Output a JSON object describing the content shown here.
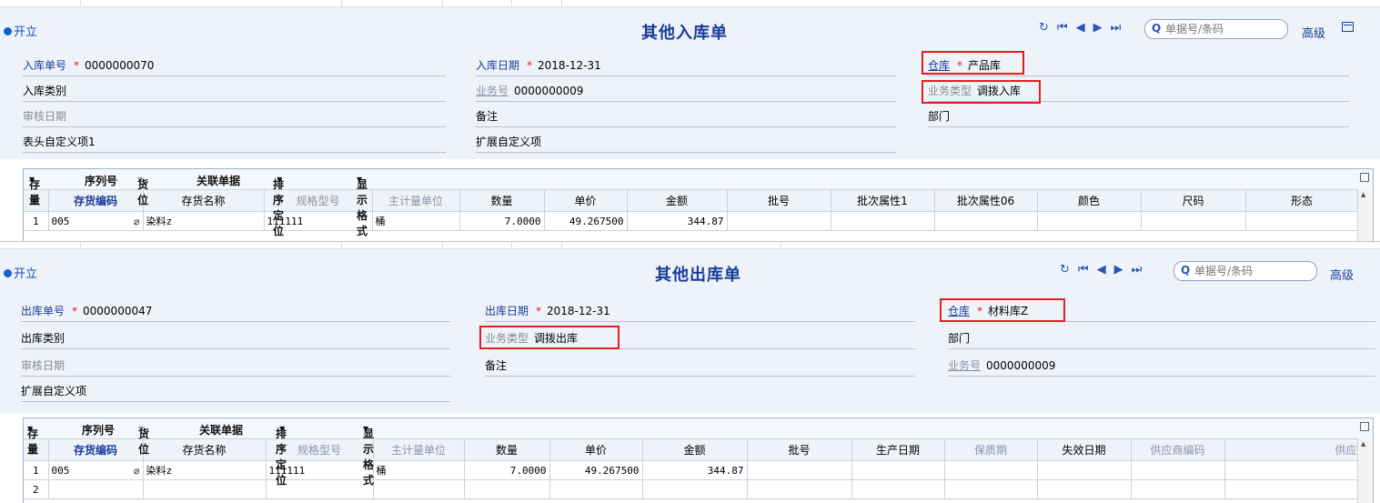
{
  "inbound": {
    "open_label": "开立",
    "title": "其他入库单",
    "search_placeholder": "单据号/条码",
    "advanced_label": "高级",
    "fields": {
      "doc_no_label": "入库单号",
      "doc_no_value": "0000000070",
      "date_label": "入库日期",
      "date_value": "2018-12-31",
      "warehouse_label": "仓库",
      "warehouse_value": "产品库",
      "category_label": "入库类别",
      "business_no_label": "业务号",
      "business_no_value": "0000000009",
      "business_type_label": "业务类型",
      "business_type_value": "调拨入库",
      "audit_date_label": "审核日期",
      "remark_label": "备注",
      "dept_label": "部门",
      "custom_header_label": "表头自定义项1",
      "ext_custom_label": "扩展自定义项"
    },
    "toolbar": [
      "存量",
      "序列号",
      "货位",
      "关联单据",
      "排序定位",
      "显示格式"
    ],
    "columns": [
      "存货编码",
      "存货名称",
      "规格型号",
      "主计量单位",
      "数量",
      "单价",
      "金额",
      "批号",
      "批次属性1",
      "批次属性06",
      "颜色",
      "尺码",
      "形态"
    ],
    "rows": [
      {
        "no": "1",
        "code": "005",
        "name": "染料z",
        "spec": "111111",
        "unit": "桶",
        "qty": "7.0000",
        "price": "49.267500",
        "amount": "344.87"
      }
    ]
  },
  "outbound": {
    "open_label": "开立",
    "title": "其他出库单",
    "search_placeholder": "单据号/条码",
    "advanced_label": "高级",
    "fields": {
      "doc_no_label": "出库单号",
      "doc_no_value": "0000000047",
      "date_label": "出库日期",
      "date_value": "2018-12-31",
      "warehouse_label": "仓库",
      "warehouse_value": "材料库Z",
      "category_label": "出库类别",
      "business_type_label": "业务类型",
      "business_type_value": "调拨出库",
      "dept_label": "部门",
      "audit_date_label": "审核日期",
      "remark_label": "备注",
      "business_no_label": "业务号",
      "business_no_value": "0000000009",
      "ext_custom_label": "扩展自定义项"
    },
    "toolbar": [
      "存量",
      "序列号",
      "货位",
      "关联单据",
      "排序定位",
      "显示格式"
    ],
    "columns": [
      "存货编码",
      "存货名称",
      "规格型号",
      "主计量单位",
      "数量",
      "单价",
      "金额",
      "批号",
      "生产日期",
      "保质期",
      "失效日期",
      "供应商编码",
      "供应"
    ],
    "rows": [
      {
        "no": "1",
        "code": "005",
        "name": "染料z",
        "spec": "111111",
        "unit": "桶",
        "qty": "7.0000",
        "price": "49.267500",
        "amount": "344.87"
      },
      {
        "no": "2"
      }
    ]
  },
  "colors": {
    "title": "#1a3c9c",
    "label_blue": "#1a3c9c",
    "required": "#e02020",
    "highlight": "#e02020",
    "header_bg": "#eef3fa"
  }
}
